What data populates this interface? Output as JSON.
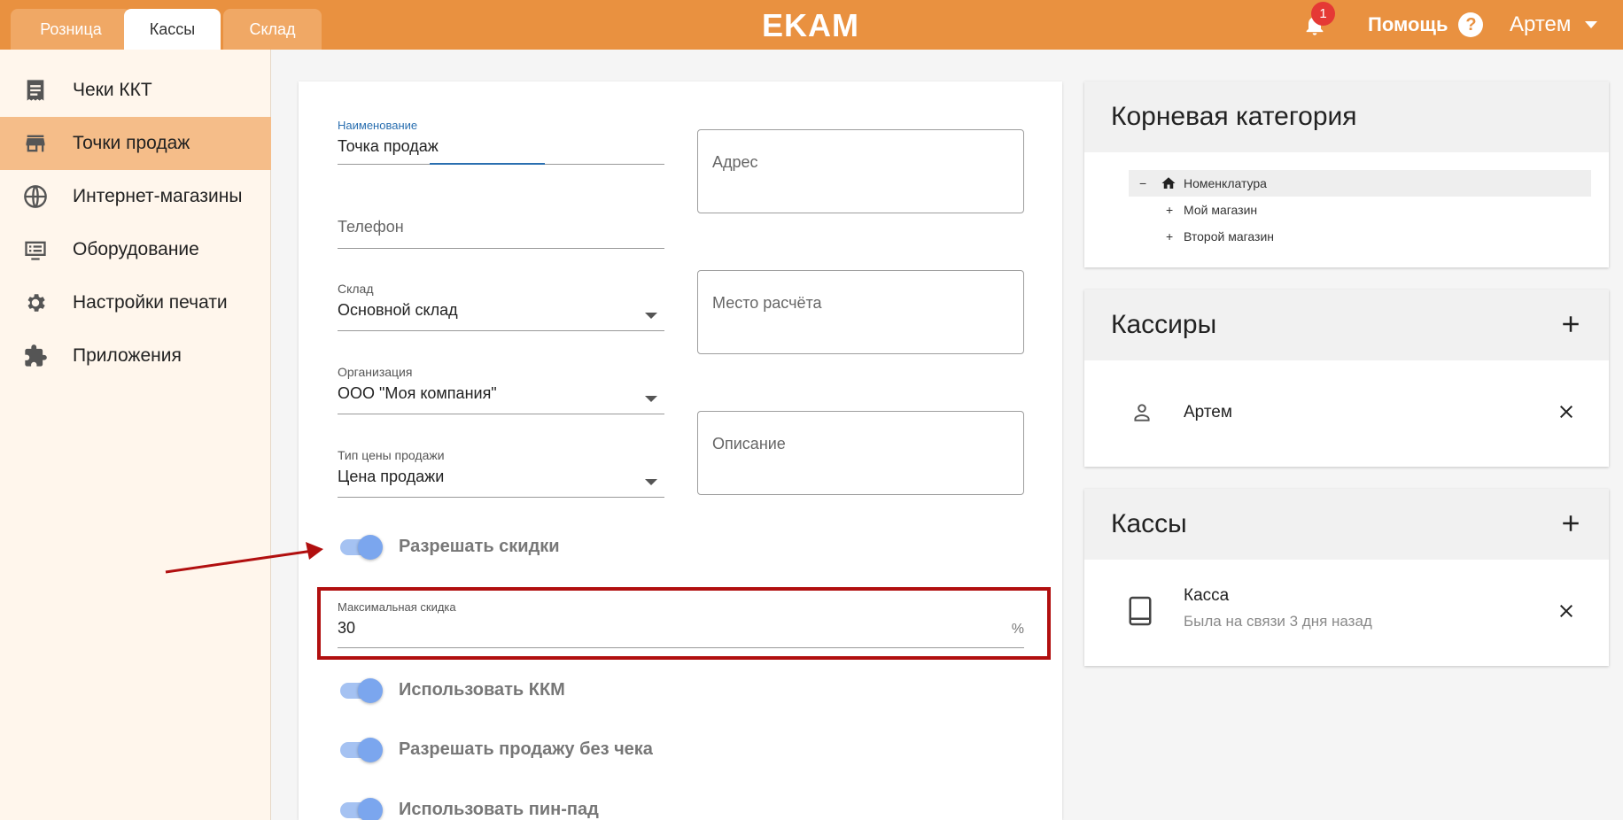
{
  "header": {
    "tabs": [
      "Розница",
      "Кассы",
      "Склад"
    ],
    "logo": "EKAM",
    "notifications_count": "1",
    "help_label": "Помощь",
    "help_glyph": "?",
    "user_name": "Артем"
  },
  "sidebar": {
    "items": [
      {
        "label": "Чеки ККТ",
        "icon": "receipt-icon"
      },
      {
        "label": "Точки продаж",
        "icon": "store-icon"
      },
      {
        "label": "Интернет-магазины",
        "icon": "globe-icon"
      },
      {
        "label": "Оборудование",
        "icon": "equipment-icon"
      },
      {
        "label": "Настройки печати",
        "icon": "gear-icon"
      },
      {
        "label": "Приложения",
        "icon": "puzzle-icon"
      }
    ],
    "active_index": 1
  },
  "form": {
    "name_label": "Наименование",
    "name_value": "Точка продаж",
    "phone_placeholder": "Телефон",
    "warehouse_label": "Склад",
    "warehouse_value": "Основной склад",
    "org_label": "Организация",
    "org_value": "ООО \"Моя компания\"",
    "price_type_label": "Тип цены продажи",
    "price_type_value": "Цена продажи",
    "address_placeholder": "Адрес",
    "payment_place_placeholder": "Место расчёта",
    "description_placeholder": "Описание",
    "allow_discounts_label": "Разрешать скидки",
    "max_discount_label": "Максимальная скидка",
    "max_discount_value": "30",
    "max_discount_unit": "%",
    "use_kkm_label": "Использовать ККМ",
    "allow_no_receipt_label": "Разрешать продажу без чека",
    "use_pinpad_label": "Использовать пин-пад"
  },
  "categories": {
    "title": "Корневая категория",
    "tree": [
      {
        "toggle": "−",
        "label": "Номенклатура"
      },
      {
        "toggle": "+",
        "label": "Мой магазин"
      },
      {
        "toggle": "+",
        "label": "Второй магазин"
      }
    ]
  },
  "cashiers": {
    "title": "Кассиры",
    "items": [
      {
        "name": "Артем"
      }
    ]
  },
  "registers": {
    "title": "Кассы",
    "items": [
      {
        "name": "Касса",
        "status": "Была на связи 3 дня назад"
      }
    ]
  },
  "colors": {
    "header_bg": "#e99140",
    "sidebar_active": "#f5bd89",
    "toggle_on": "#7ba6ee",
    "highlight": "#b10f0f"
  }
}
